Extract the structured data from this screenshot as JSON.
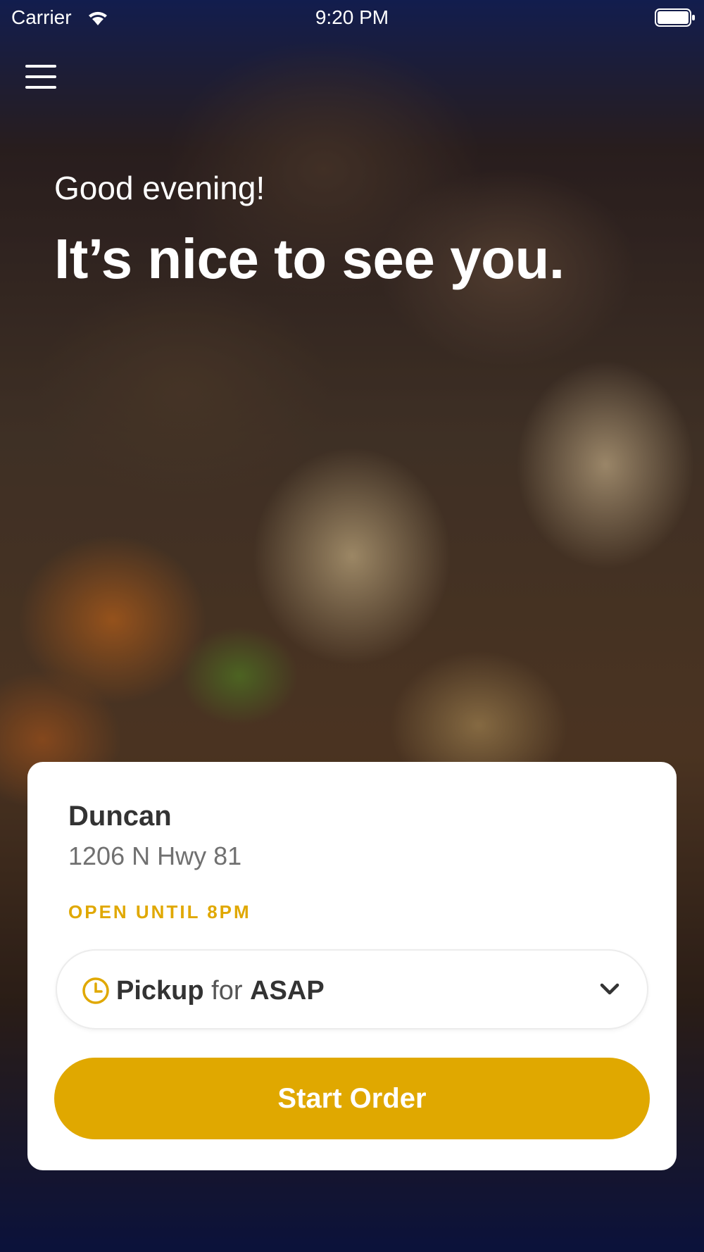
{
  "status_bar": {
    "carrier": "Carrier",
    "time": "9:20 PM"
  },
  "hero": {
    "greeting": "Good evening!",
    "headline": "It’s nice to see you."
  },
  "store": {
    "name": "Duncan",
    "address": "1206 N Hwy 81",
    "hours": "OPEN UNTIL 8PM"
  },
  "order_mode": {
    "mode": "Pickup",
    "connector": "for",
    "time": "ASAP",
    "icon": "clock-icon"
  },
  "actions": {
    "start_order": "Start Order"
  },
  "colors": {
    "accent": "#e0a800"
  }
}
